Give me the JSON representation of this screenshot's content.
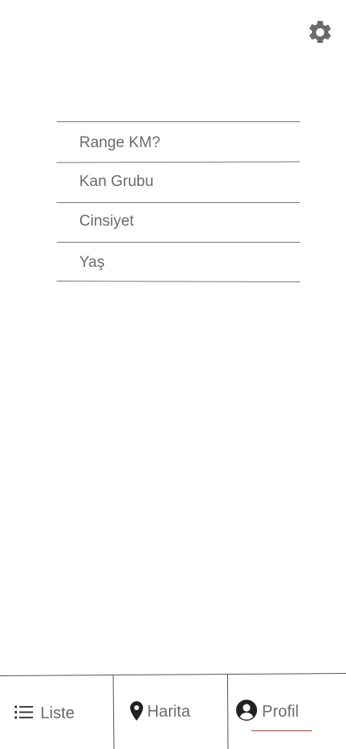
{
  "header": {
    "settings_icon": "gear-icon"
  },
  "profile_fields": [
    {
      "label": "Range KM?"
    },
    {
      "label": "Kan Grubu"
    },
    {
      "label": "Cinsiyet"
    },
    {
      "label": "Yaş"
    }
  ],
  "bottom_nav": {
    "tabs": [
      {
        "label": "Liste",
        "icon": "list-icon"
      },
      {
        "label": "Harita",
        "icon": "map-pin-icon"
      },
      {
        "label": "Profil",
        "icon": "user-circle-icon"
      }
    ],
    "active_tab": "Profil",
    "active_color": "#c0392b"
  },
  "colors": {
    "icon": "#6b6b6b",
    "divider": "#777777",
    "text": "#6b6b6b"
  }
}
